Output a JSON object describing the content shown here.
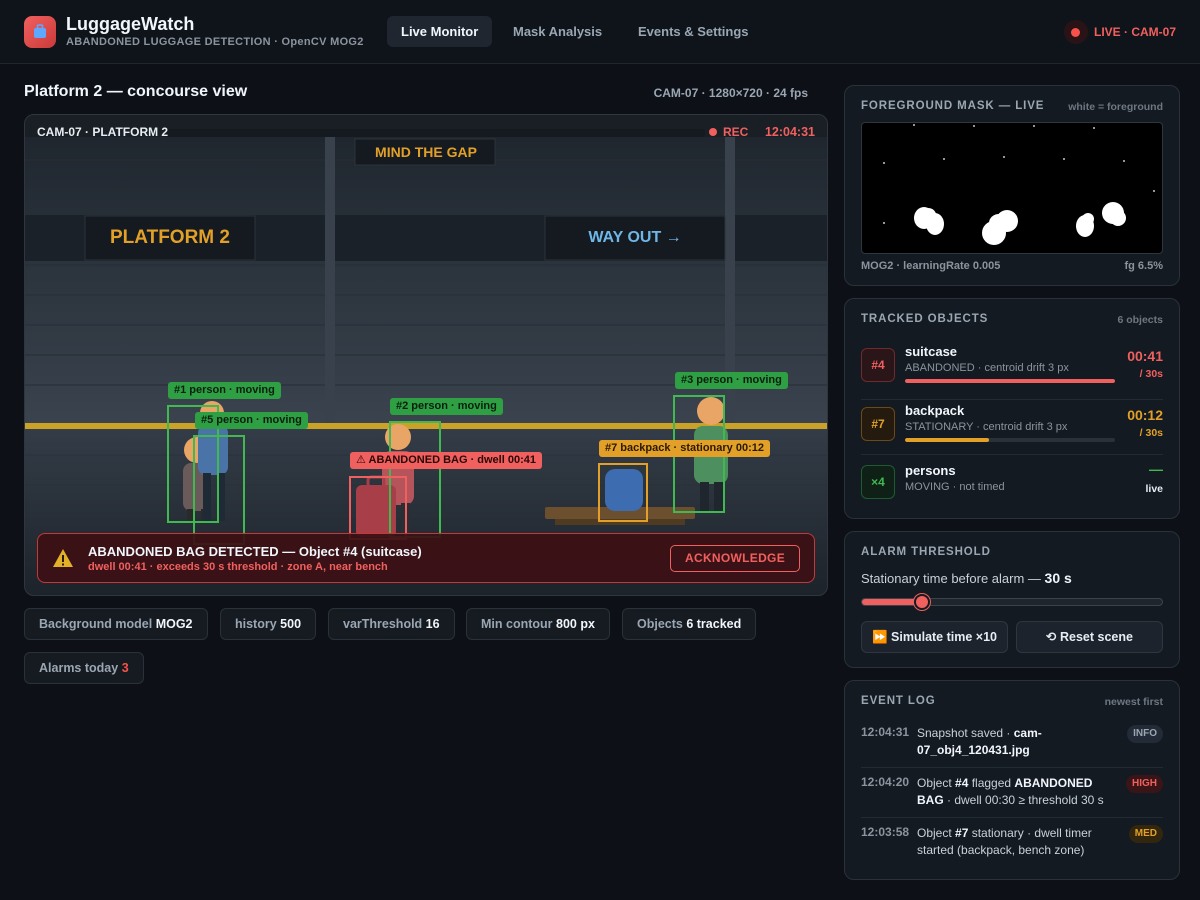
{
  "app": {
    "title": "LuggageWatch",
    "subtitle": "ABANDONED LUGGAGE DETECTION · OpenCV MOG2",
    "logo_icon": "luggage-icon"
  },
  "nav": {
    "tabs": [
      {
        "label": "Live Monitor",
        "active": true
      },
      {
        "label": "Mask Analysis",
        "active": false
      },
      {
        "label": "Events & Settings",
        "active": false
      }
    ],
    "live_label": "LIVE · CAM-07"
  },
  "view": {
    "title": "Platform 2 — concourse view",
    "meta": "CAM-07 · 1280×720 · 24 fps"
  },
  "video": {
    "overlay_cam": "CAM-07 · PLATFORM 2",
    "rec_label": "REC",
    "timestamp": "12:04:31",
    "signs": {
      "mind_gap": "MIND THE GAP",
      "platform": "PLATFORM 2",
      "way_out": "WAY OUT →"
    },
    "tags": {
      "p1": "#1 person · moving",
      "p5": "#5 person · moving",
      "p2": "#2 person · moving",
      "p3": "#3 person · moving",
      "abandoned": "⚠ ABANDONED BAG · dwell 00:41",
      "backpack": "#7 backpack · stationary 00:12"
    }
  },
  "alert": {
    "title": "ABANDONED BAG DETECTED — Object #4 (suitcase)",
    "detail": "dwell 00:41 · exceeds 30 s threshold · zone A, near bench",
    "button": "ACKNOWLEDGE",
    "icon": "warning-icon"
  },
  "stats": [
    {
      "label": "Background model",
      "value": "MOG2"
    },
    {
      "label": "history",
      "value": "500"
    },
    {
      "label": "varThreshold",
      "value": "16"
    },
    {
      "label": "Min contour",
      "value": "800 px"
    },
    {
      "label": "Objects",
      "value": "6 tracked"
    },
    {
      "label": "Alarms today",
      "value": "3"
    }
  ],
  "mask": {
    "title": "FOREGROUND MASK — LIVE",
    "note": "white = foreground",
    "model_info": "MOG2 · learningRate 0.005",
    "fg_ratio": "fg 6.5%"
  },
  "tracked": {
    "title": "TRACKED OBJECTS",
    "count": "6 objects",
    "items": [
      {
        "badge": "#4",
        "name": "suitcase",
        "desc": "ABANDONED · centroid drift 3 px",
        "time": "00:41",
        "limit": "/ 30s",
        "progress": 1.0,
        "color": "#f0605e"
      },
      {
        "badge": "#7",
        "name": "backpack",
        "desc": "STATIONARY · centroid drift 3 px",
        "time": "00:12",
        "limit": "/ 30s",
        "progress": 0.4,
        "color": "#e3a028"
      },
      {
        "badge": "×4",
        "name": "persons",
        "desc": "MOVING · not timed",
        "time": "—",
        "limit": "live",
        "color": "#3fb950"
      }
    ]
  },
  "threshold": {
    "title": "ALARM THRESHOLD",
    "label": "Stationary time before alarm —",
    "value": "30 s",
    "slider_fraction": 0.2,
    "simulate_button": "⏩ Simulate time ×10",
    "reset_button": "⟲ Reset scene"
  },
  "events": {
    "title": "EVENT LOG",
    "note": "newest first",
    "items": [
      {
        "time": "12:04:31",
        "pre": "Snapshot saved · ",
        "strong": "cam-07_obj4_120431.jpg",
        "mid": "",
        "strong2": "",
        "post": "",
        "level": "INFO"
      },
      {
        "time": "12:04:20",
        "pre": "Object ",
        "strong": "#4",
        "mid": " flagged ",
        "strong2": "ABANDONED BAG",
        "post": " · dwell 00:30 ≥ threshold 30 s",
        "level": "HIGH"
      },
      {
        "time": "12:03:58",
        "pre": "Object ",
        "strong": "#7",
        "mid": " stationary · dwell timer started (backpack, bench zone)",
        "strong2": "",
        "post": "",
        "level": "MED"
      }
    ]
  },
  "colors": {
    "accent_red": "#f0605e",
    "amber": "#e3a028",
    "green": "#3fb950",
    "background": "#0d1117",
    "card": "#141a21"
  }
}
